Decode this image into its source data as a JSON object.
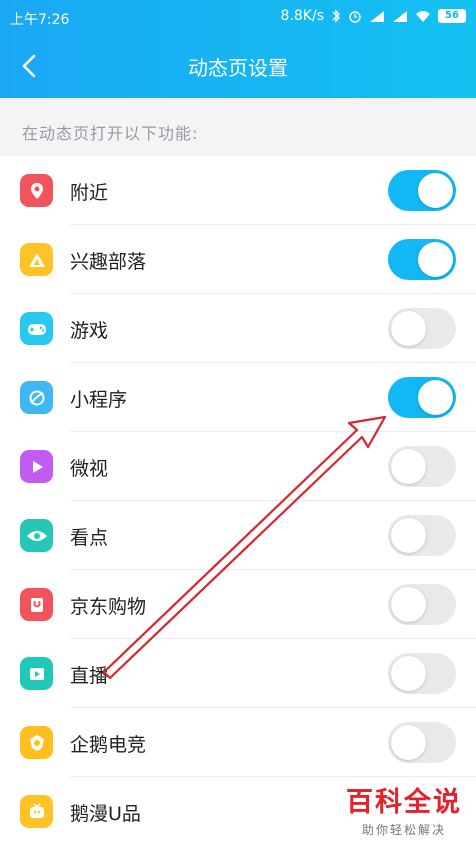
{
  "status_bar": {
    "time": "上午7:26",
    "speed": "8.8K/s",
    "battery": "56"
  },
  "nav": {
    "title": "动态页设置",
    "back_icon": "chevron-left-icon"
  },
  "section_hint": "在动态页打开以下功能:",
  "items": [
    {
      "label": "附近",
      "icon": "location-pin-icon",
      "icon_color": "#f2545b",
      "on": true
    },
    {
      "label": "兴趣部落",
      "icon": "tribe-triangle-icon",
      "icon_color": "#ffc325",
      "on": true
    },
    {
      "label": "游戏",
      "icon": "gamepad-icon",
      "icon_color": "#28c8f0",
      "on": false
    },
    {
      "label": "小程序",
      "icon": "mini-program-icon",
      "icon_color": "#3eb8f2",
      "on": true
    },
    {
      "label": "微视",
      "icon": "play-video-icon",
      "icon_color": "#c05cf2",
      "on": false
    },
    {
      "label": "看点",
      "icon": "eye-icon",
      "icon_color": "#26c7b6",
      "on": false
    },
    {
      "label": "京东购物",
      "icon": "shopping-bag-icon",
      "icon_color": "#f2545b",
      "on": false
    },
    {
      "label": "直播",
      "icon": "live-broadcast-icon",
      "icon_color": "#1fc8b7",
      "on": false
    },
    {
      "label": "企鹅电竞",
      "icon": "esports-badge-icon",
      "icon_color": "#ffbf1f",
      "on": false
    },
    {
      "label": "鹅漫U品",
      "icon": "comic-tv-icon",
      "icon_color": "#ffc325",
      "on": null
    }
  ],
  "watermark": {
    "title": "百科全说",
    "subtitle": "助你轻松解决"
  },
  "colors": {
    "header_start": "#1aa8f5",
    "header_end": "#13c1f1",
    "toggle_on": "#12b7f5",
    "toggle_off": "#e9e9ec",
    "annotation_arrow": "#d8252e"
  }
}
